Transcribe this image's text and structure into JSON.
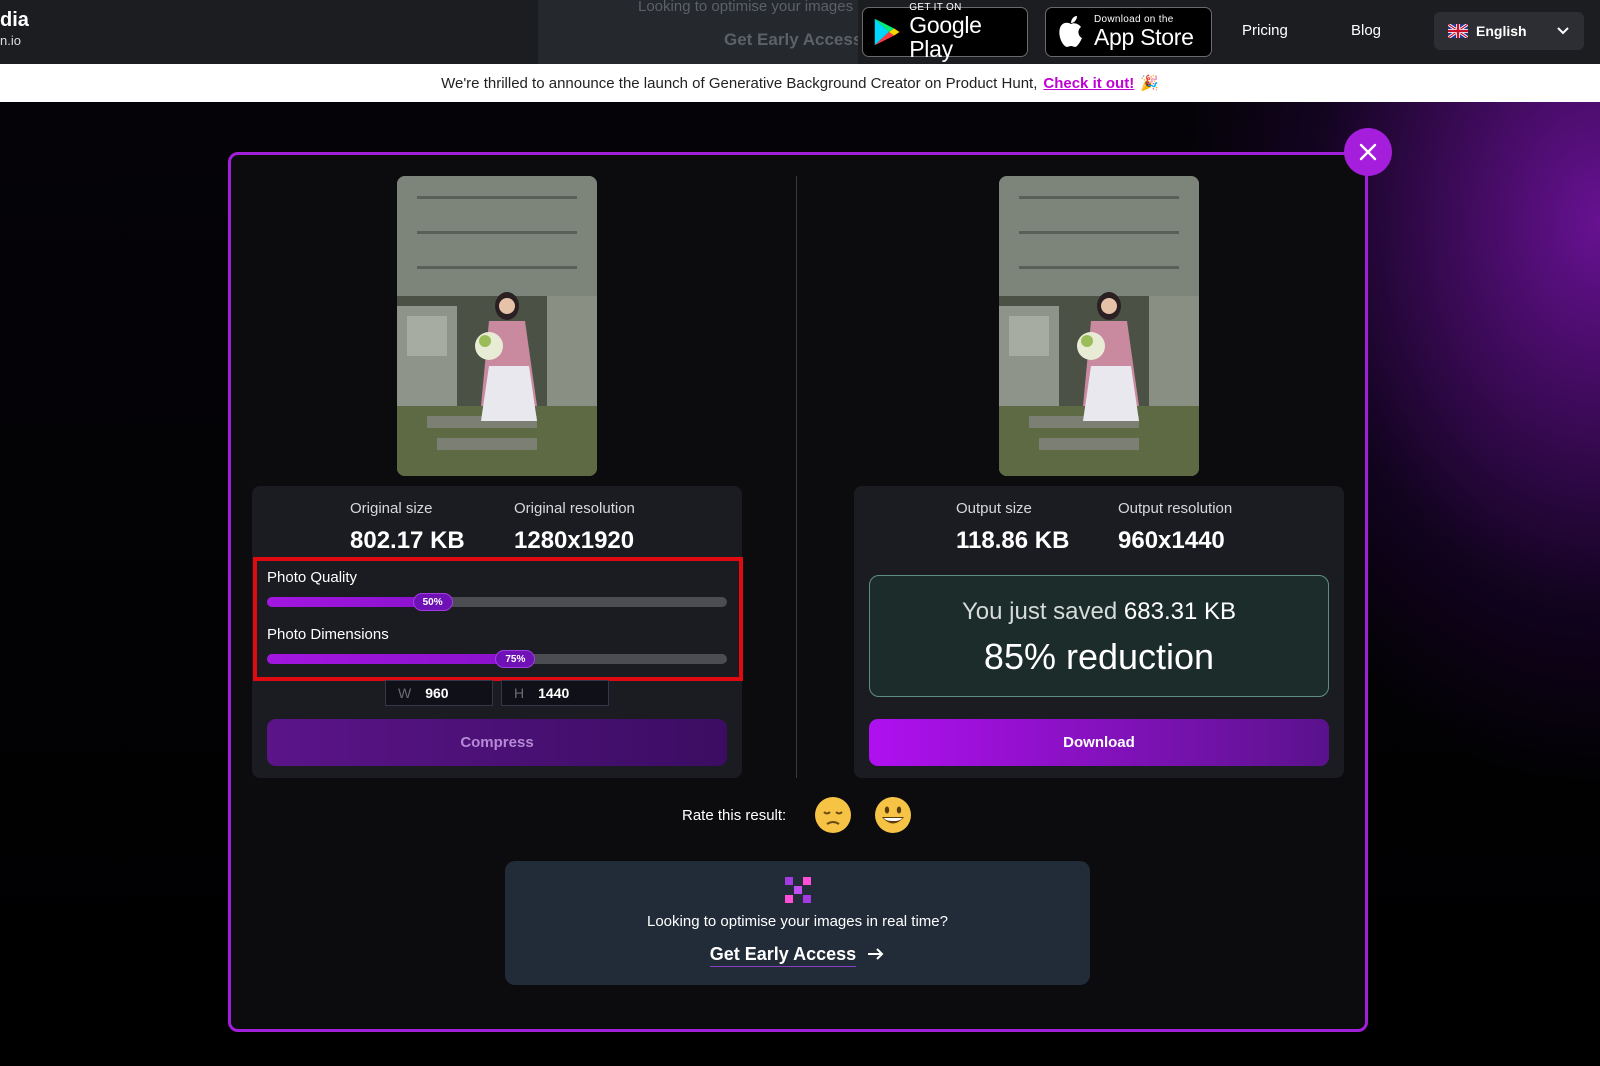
{
  "nav": {
    "brand_line1": "dia",
    "brand_line2": "n.io",
    "ghost_text": "Looking to optimise your images in real time?",
    "ghost_link": "Get Early Access",
    "google_play_small": "GET IT ON",
    "google_play_large": "Google Play",
    "app_store_small": "Download on the",
    "app_store_large": "App Store",
    "pricing": "Pricing",
    "blog": "Blog",
    "language": "English"
  },
  "announcement": {
    "text": "We're thrilled to announce the launch of Generative Background Creator on Product Hunt,",
    "link": "Check it out!",
    "emoji": "🎉"
  },
  "original": {
    "size_label": "Original size",
    "size_value": "802.17 KB",
    "res_label": "Original resolution",
    "res_value": "1280x1920"
  },
  "sliders": {
    "quality_label": "Photo Quality",
    "quality_value": 50,
    "quality_text": "50%",
    "dimensions_label": "Photo Dimensions",
    "dimensions_value": 75,
    "dimensions_text": "75%"
  },
  "dimensions": {
    "w_label": "W",
    "w_value": "960",
    "h_label": "H",
    "h_value": "1440"
  },
  "compress_label": "Compress",
  "output": {
    "size_label": "Output size",
    "size_value": "118.86 KB",
    "res_label": "Output resolution",
    "res_value": "960x1440"
  },
  "saved": {
    "prefix": "You just saved",
    "amount": "683.31 KB",
    "reduction": "85% reduction"
  },
  "download_label": "Download",
  "rate_label": "Rate this result:",
  "cta": {
    "text": "Looking to optimise your images in real time?",
    "link": "Get Early Access"
  },
  "colors": {
    "accent": "#a11fd9",
    "highlight_box": "#e10a10"
  }
}
